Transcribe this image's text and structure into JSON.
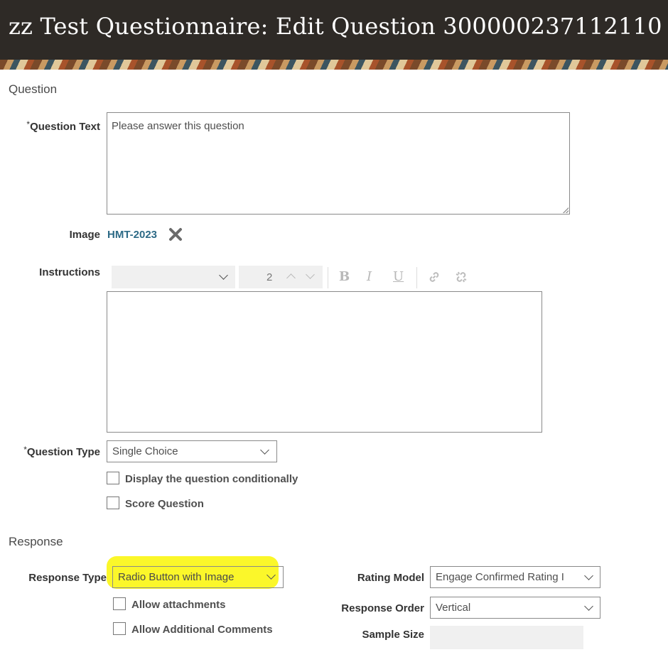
{
  "page": {
    "title": "zz Test Questionnaire: Edit Question 300000237112110"
  },
  "question_section": {
    "heading": "Question",
    "required_mark": "*",
    "question_text": {
      "label": "Question Text",
      "value": "Please answer this question"
    },
    "image": {
      "label": "Image",
      "value": "HMT-2023"
    },
    "instructions": {
      "label": "Instructions",
      "font_size_value": "2",
      "icons": [
        "bold-icon",
        "italic-icon",
        "underline-icon",
        "link-icon",
        "unlink-icon"
      ],
      "bold_glyph": "B",
      "italic_glyph": "I",
      "underline_glyph": "U"
    },
    "question_type": {
      "label": "Question Type",
      "value": "Single Choice"
    },
    "checkboxes": [
      {
        "label": "Display the question conditionally",
        "checked": false
      },
      {
        "label": "Score Question",
        "checked": false
      }
    ]
  },
  "response_section": {
    "heading": "Response",
    "response_type": {
      "label": "Response Type",
      "value": "Radio Button with Image",
      "highlight_color": "#fbf72a"
    },
    "checkboxes": [
      {
        "label": "Allow attachments",
        "checked": false
      },
      {
        "label": "Allow Additional Comments",
        "checked": false
      }
    ],
    "rating_model": {
      "label": "Rating Model",
      "value": "Engage Confirmed Rating I"
    },
    "response_order": {
      "label": "Response Order",
      "value": "Vertical"
    },
    "sample_size": {
      "label": "Sample Size",
      "value": ""
    }
  },
  "colors": {
    "header_bg": "#2e2a26",
    "link": "#2d6a86",
    "highlight": "#fbf72a"
  }
}
